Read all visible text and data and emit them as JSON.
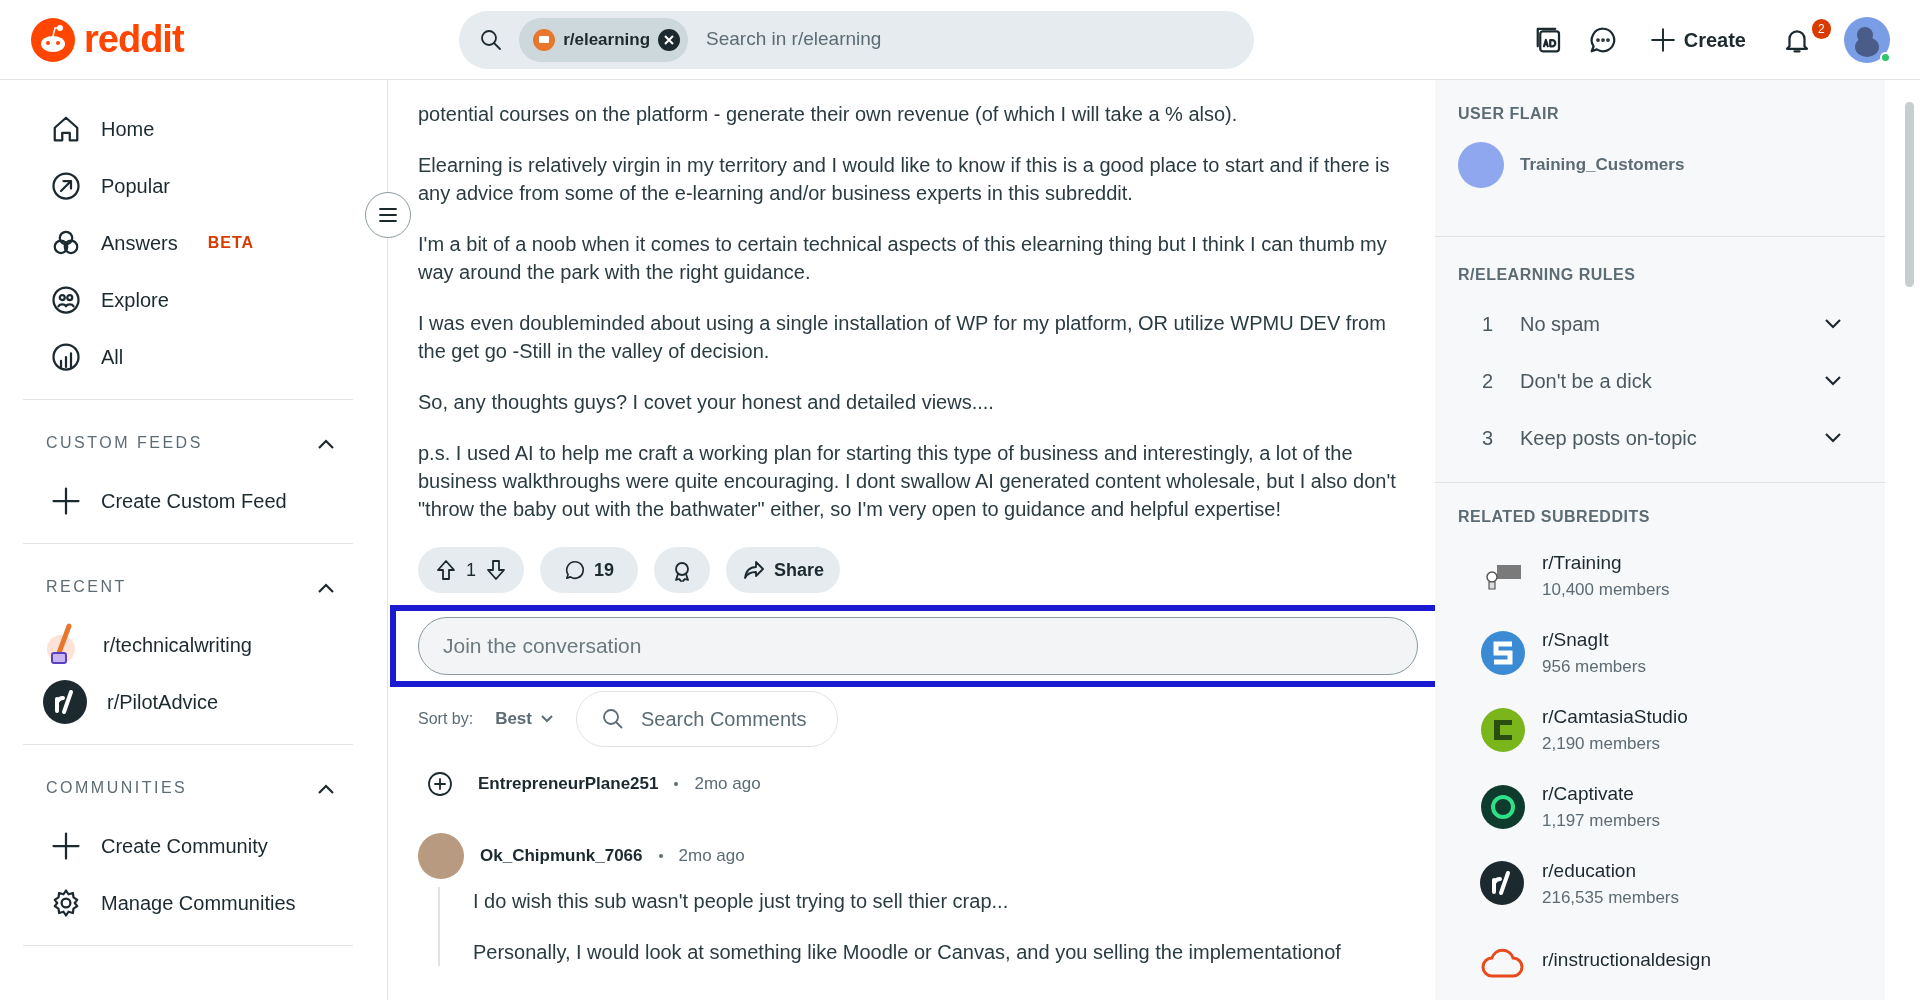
{
  "header": {
    "logo": "reddit",
    "search": {
      "community": "r/elearning",
      "placeholder": "Search in r/elearning"
    },
    "create": "Create",
    "notifications": "2"
  },
  "sidebar": {
    "nav": [
      {
        "label": "Home"
      },
      {
        "label": "Popular"
      },
      {
        "label": "Answers",
        "badge": "BETA"
      },
      {
        "label": "Explore"
      },
      {
        "label": "All"
      }
    ],
    "sections": [
      {
        "title": "CUSTOM FEEDS",
        "expanded": true,
        "items": [
          {
            "label": "Create Custom Feed"
          }
        ]
      },
      {
        "title": "RECENT",
        "expanded": true,
        "items": [
          {
            "label": "r/technicalwriting"
          },
          {
            "label": "r/PilotAdvice"
          }
        ]
      },
      {
        "title": "COMMUNITIES",
        "expanded": true,
        "items": [
          {
            "label": "Create Community"
          },
          {
            "label": "Manage Communities"
          }
        ]
      }
    ]
  },
  "post": {
    "paragraphs": [
      "potential courses on the platform - generate their own revenue (of which I will take a % also).",
      "Elearning is relatively virgin in my territory and I would like to know if this is a good place to start and if there is any advice from some of the e-learning and/or business experts in this subreddit.",
      "I'm a bit of a noob when it comes to certain technical aspects of this elearning thing but I think I can thumb my way around the park with the right guidance.",
      "I was even doubleminded about using a single installation of WP for my platform, OR utilize WPMU DEV from the get go -Still in the valley of decision.",
      "So, any thoughts guys? I covet your honest and detailed views....",
      "p.s. I used AI to help me craft a working plan for starting this type of business and interestingly, a lot of the business walkthroughs were quite encouraging. I dont swallow AI generated content wholesale, but I also don't \"throw the baby out with the bathwater\" either, so I'm very open to guidance and helpful expertise!"
    ],
    "votes": "1",
    "comments": "19",
    "share": "Share"
  },
  "composer": {
    "placeholder": "Join the conversation",
    "highlighted": true
  },
  "sort": {
    "label": "Sort by:",
    "value": "Best"
  },
  "comment_search": {
    "placeholder": "Search Comments"
  },
  "comments": [
    {
      "author": "EntrepreneurPlane251",
      "time": "2mo ago",
      "collapsed": true
    },
    {
      "author": "Ok_Chipmunk_7066",
      "time": "2mo ago",
      "collapsed": false,
      "paragraphs": [
        "I do wish this sub wasn't people just trying to sell thier crap...",
        "Personally, I would look at something like Moodle or Canvas, and you selling the implementationof"
      ]
    }
  ],
  "right": {
    "user_flair": {
      "title": "USER FLAIR",
      "name": "Training_Customers"
    },
    "rules": {
      "title": "R/ELEARNING RULES",
      "items": [
        {
          "number": "1",
          "text": "No spam",
          "expanded": false
        },
        {
          "number": "2",
          "text": "Don't be a dick",
          "expanded": false
        },
        {
          "number": "3",
          "text": "Keep posts on-topic",
          "expanded": false
        }
      ]
    },
    "related": {
      "title": "RELATED SUBREDDITS",
      "items": [
        {
          "name": "r/Training",
          "members": "10,400 members"
        },
        {
          "name": "r/SnagIt",
          "members": "956 members"
        },
        {
          "name": "r/CamtasiaStudio",
          "members": "2,190 members"
        },
        {
          "name": "r/Captivate",
          "members": "1,197 members"
        },
        {
          "name": "r/education",
          "members": "216,535 members"
        },
        {
          "name": "r/instructionaldesign"
        }
      ]
    }
  }
}
